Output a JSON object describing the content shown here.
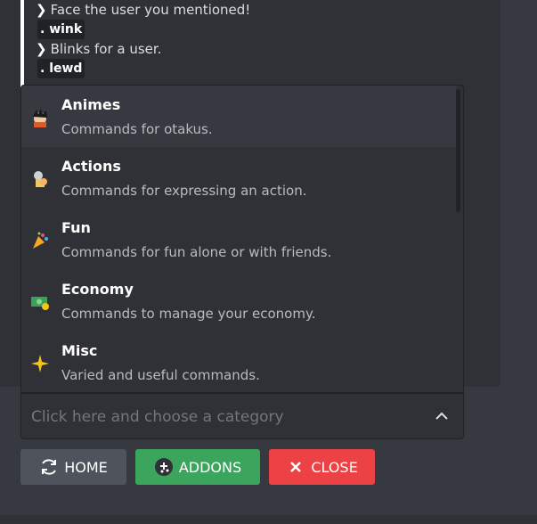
{
  "embed": {
    "lines": [
      {
        "type": "text",
        "text": "Face the user you mentioned!"
      },
      {
        "type": "code",
        "text": ". wink"
      },
      {
        "type": "text",
        "text": "Blinks for a user."
      },
      {
        "type": "code",
        "text": ". lewd"
      }
    ]
  },
  "menu": {
    "options": [
      {
        "label": "Animes",
        "description": "Commands for otakus.",
        "icon": "anime-character-icon"
      },
      {
        "label": "Actions",
        "description": "Commands for expressing an action.",
        "icon": "action-trophy-icon"
      },
      {
        "label": "Fun",
        "description": "Commands for fun alone or with friends.",
        "icon": "party-popper-icon"
      },
      {
        "label": "Economy",
        "description": "Commands to manage your economy.",
        "icon": "money-icon"
      },
      {
        "label": "Misc",
        "description": "Varied and useful commands.",
        "icon": "sparkle-icon"
      }
    ]
  },
  "select": {
    "placeholder": "Click here and choose a category"
  },
  "buttons": {
    "home": "HOME",
    "addons": "ADDONS",
    "close": "CLOSE"
  },
  "colors": {
    "home": "#4f545c",
    "addons": "#3ba55d",
    "close": "#ed4245",
    "background": "#36393f"
  }
}
